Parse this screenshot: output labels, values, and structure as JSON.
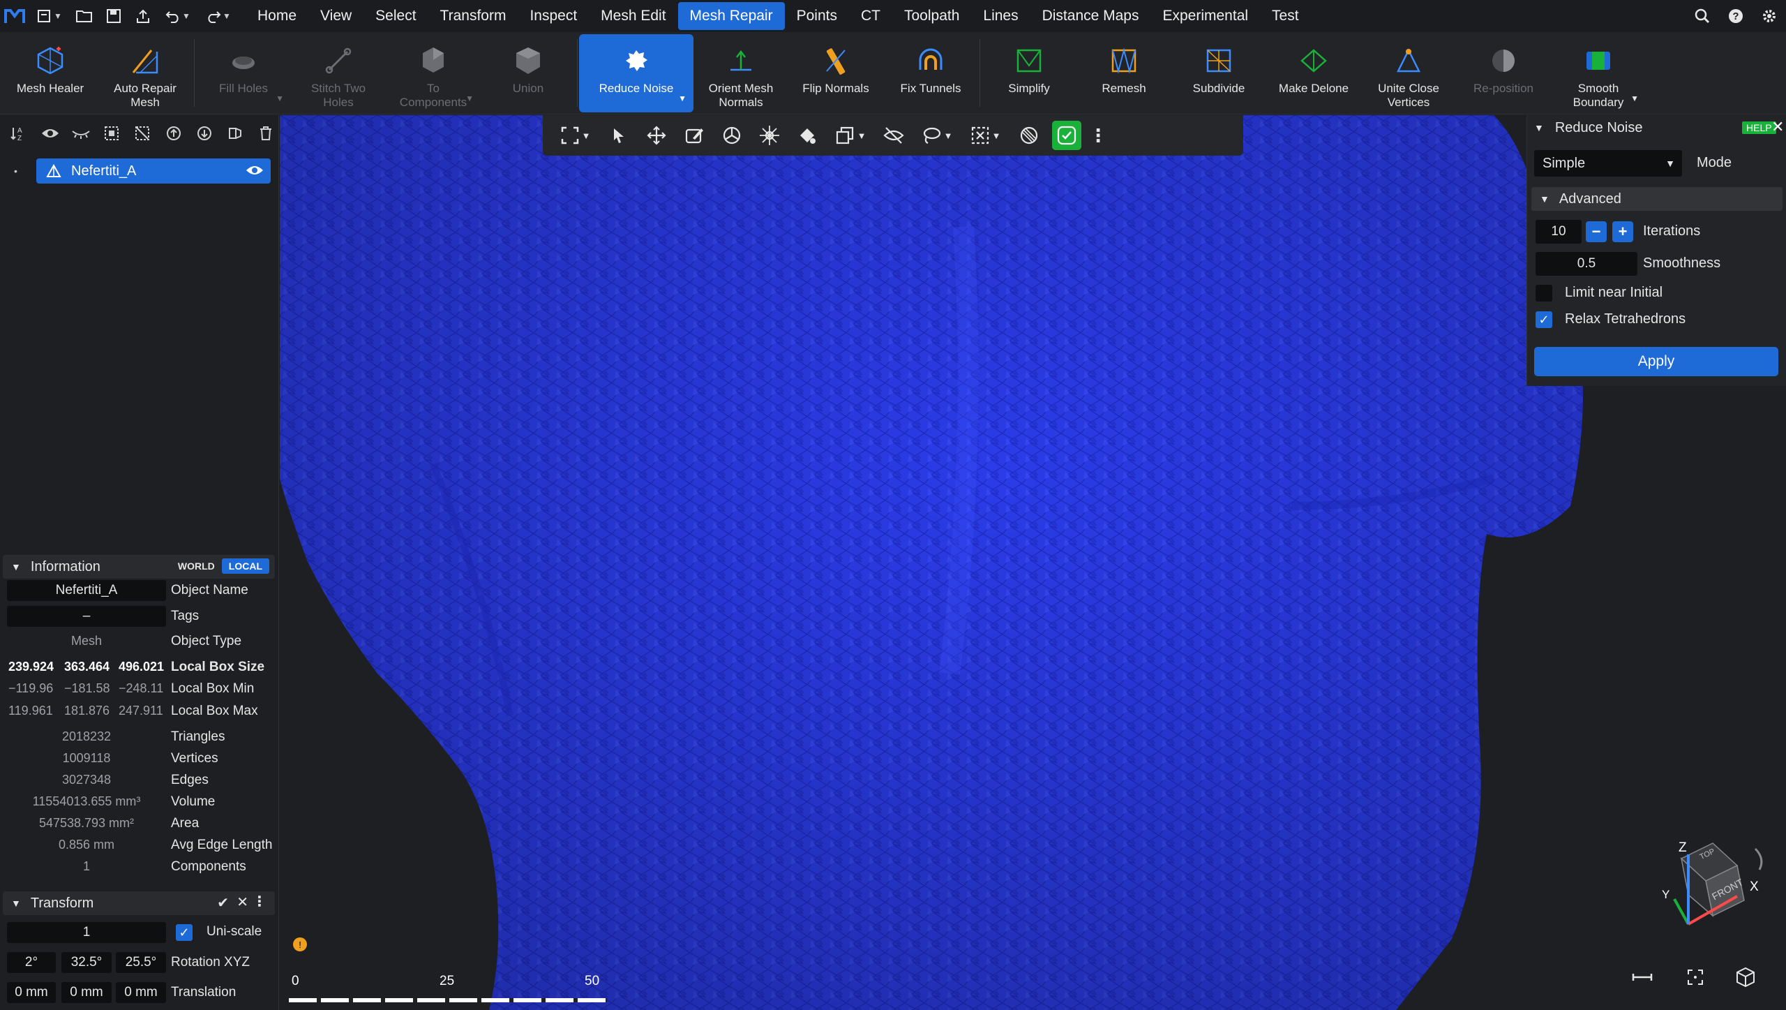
{
  "menu": {
    "tabs": [
      {
        "label": "Home"
      },
      {
        "label": "View"
      },
      {
        "label": "Select"
      },
      {
        "label": "Transform"
      },
      {
        "label": "Inspect"
      },
      {
        "label": "Mesh Edit"
      },
      {
        "label": "Mesh Repair",
        "active": true
      },
      {
        "label": "Points"
      },
      {
        "label": "CT"
      },
      {
        "label": "Toolpath"
      },
      {
        "label": "Lines"
      },
      {
        "label": "Distance Maps"
      },
      {
        "label": "Experimental"
      },
      {
        "label": "Test"
      }
    ],
    "left_icons": [
      "logo-icon",
      "app-menu-icon",
      "open-folder-icon",
      "save-icon",
      "export-icon",
      "undo-icon",
      "redo-icon"
    ],
    "right_icons": [
      "search-icon",
      "help-icon",
      "settings-gear-icon"
    ]
  },
  "ribbon": {
    "tools": [
      {
        "label": "Mesh Healer",
        "icon": "mesh-healer-icon",
        "state": "enabled"
      },
      {
        "label": "Auto Repair Mesh",
        "icon": "auto-repair-icon",
        "state": "enabled"
      },
      {
        "label": "Fill Holes",
        "icon": "fill-holes-icon",
        "state": "disabled",
        "caret": true
      },
      {
        "label": "Stitch Two Holes",
        "icon": "stitch-icon",
        "state": "disabled"
      },
      {
        "label": "To Components",
        "icon": "components-icon",
        "state": "disabled",
        "caret": true
      },
      {
        "label": "Union",
        "icon": "union-icon",
        "state": "disabled"
      },
      {
        "label": "Reduce Noise",
        "icon": "reduce-noise-icon",
        "state": "active",
        "caret": true
      },
      {
        "label": "Orient Mesh Normals",
        "icon": "orient-normals-icon",
        "state": "enabled"
      },
      {
        "label": "Flip Normals",
        "icon": "flip-normals-icon",
        "state": "enabled"
      },
      {
        "label": "Fix Tunnels",
        "icon": "fix-tunnels-icon",
        "state": "enabled"
      },
      {
        "label": "Simplify",
        "icon": "simplify-icon",
        "state": "enabled"
      },
      {
        "label": "Remesh",
        "icon": "remesh-icon",
        "state": "enabled"
      },
      {
        "label": "Subdivide",
        "icon": "subdivide-icon",
        "state": "enabled"
      },
      {
        "label": "Make Delone",
        "icon": "make-delone-icon",
        "state": "enabled"
      },
      {
        "label": "Unite Close Vertices",
        "icon": "unite-vertices-icon",
        "state": "enabled"
      },
      {
        "label": "Re-position",
        "icon": "reposition-icon",
        "state": "disabled"
      },
      {
        "label": "Smooth Boundary",
        "icon": "smooth-boundary-icon",
        "state": "enabled",
        "caret": true
      }
    ]
  },
  "scene": {
    "toolbar_icons": [
      "sort-icon",
      "show-eye-icon",
      "hide-eye-icon",
      "select-all-icon",
      "deselect-icon",
      "move-up-icon",
      "move-down-icon",
      "mirror-icon",
      "delete-icon"
    ],
    "object_name": "Nefertiti_A"
  },
  "info": {
    "title": "Information",
    "world": "WORLD",
    "local": "LOCAL",
    "object_name_value": "Nefertiti_A",
    "object_name_label": "Object Name",
    "tags_value": "–",
    "tags_label": "Tags",
    "object_type_value": "Mesh",
    "object_type_label": "Object Type",
    "box_size": [
      "239.924",
      "363.464",
      "496.021"
    ],
    "box_size_label": "Local Box Size",
    "box_min": [
      "−119.96",
      "−181.58",
      "−248.11"
    ],
    "box_min_label": "Local Box Min",
    "box_max": [
      "119.961",
      "181.876",
      "247.911"
    ],
    "box_max_label": "Local Box Max",
    "stats": [
      {
        "value": "2018232",
        "label": "Triangles"
      },
      {
        "value": "1009118",
        "label": "Vertices"
      },
      {
        "value": "3027348",
        "label": "Edges"
      },
      {
        "value": "11554013.655 mm³",
        "label": "Volume"
      },
      {
        "value": "547538.793 mm²",
        "label": "Area"
      },
      {
        "value": "0.856 mm",
        "label": "Avg Edge Length"
      },
      {
        "value": "1",
        "label": "Components"
      }
    ]
  },
  "transform": {
    "title": "Transform",
    "scale_value": "1",
    "uniscale_label": "Uni-scale",
    "rotation": [
      "2°",
      "32.5°",
      "25.5°"
    ],
    "rotation_label": "Rotation XYZ",
    "translation": [
      "0 mm",
      "0 mm",
      "0 mm"
    ],
    "translation_label": "Translation"
  },
  "viewport": {
    "toolbar_icons": [
      "fit-view-icon",
      "select-cursor-icon",
      "move-icon",
      "pencil-edit-icon",
      "orbit-icon",
      "gyro-icon",
      "paint-bucket-icon",
      "layers-icon",
      "hide-tool-icon",
      "lasso-icon",
      "box-select-icon",
      "no-symbol-icon",
      "confirm-check-icon",
      "more-vertical-icon"
    ],
    "ruler": {
      "labels": [
        "0",
        "25",
        "50"
      ]
    },
    "gizmo": {
      "top": "TOP",
      "front": "FRONT",
      "x": "X",
      "y": "Y",
      "z": "Z"
    },
    "bottom_right_icons": [
      "ruler-measure-icon",
      "focus-center-icon",
      "view-cube-icon"
    ],
    "mesh_color": "#2a3cf0"
  },
  "panel": {
    "title": "Reduce Noise",
    "help": "HELP",
    "mode_value": "Simple",
    "mode_label": "Mode",
    "advanced_label": "Advanced",
    "iterations_value": "10",
    "iterations_label": "Iterations",
    "smoothness_value": "0.5",
    "smoothness_label": "Smoothness",
    "limit_label": "Limit near Initial",
    "limit_checked": false,
    "relax_label": "Relax Tetrahedrons",
    "relax_checked": true,
    "apply_label": "Apply"
  },
  "colors": {
    "accent": "#1e6ad7",
    "ok_green": "#19b13a",
    "background": "#1e1f22"
  }
}
